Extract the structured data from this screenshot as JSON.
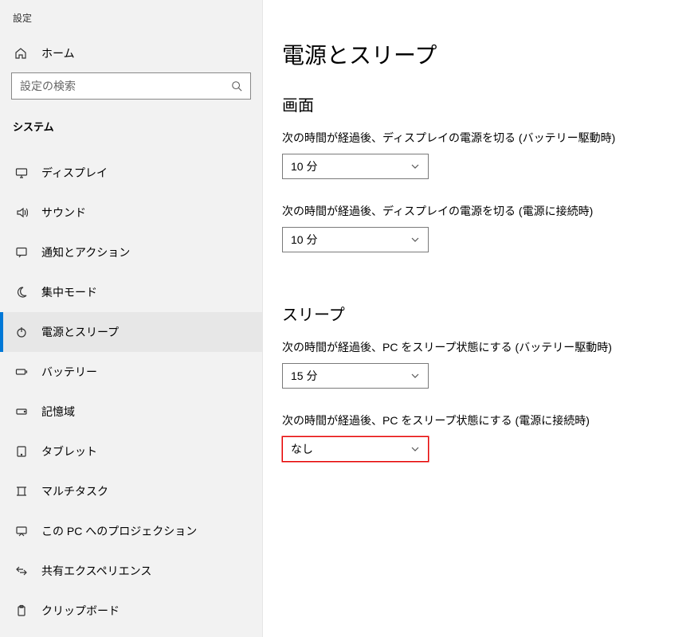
{
  "app_title": "設定",
  "sidebar": {
    "home_label": "ホーム",
    "search_placeholder": "設定の検索",
    "category": "システム",
    "items": [
      {
        "id": "display",
        "label": "ディスプレイ",
        "icon": "display-icon"
      },
      {
        "id": "sound",
        "label": "サウンド",
        "icon": "sound-icon"
      },
      {
        "id": "notifications",
        "label": "通知とアクション",
        "icon": "notification-icon"
      },
      {
        "id": "focus",
        "label": "集中モード",
        "icon": "moon-icon"
      },
      {
        "id": "power",
        "label": "電源とスリープ",
        "icon": "power-icon",
        "active": true
      },
      {
        "id": "battery",
        "label": "バッテリー",
        "icon": "battery-icon"
      },
      {
        "id": "storage",
        "label": "記憶域",
        "icon": "storage-icon"
      },
      {
        "id": "tablet",
        "label": "タブレット",
        "icon": "tablet-icon"
      },
      {
        "id": "multitask",
        "label": "マルチタスク",
        "icon": "multitask-icon"
      },
      {
        "id": "projection",
        "label": "この PC へのプロジェクション",
        "icon": "projection-icon"
      },
      {
        "id": "shared",
        "label": "共有エクスペリエンス",
        "icon": "shared-icon"
      },
      {
        "id": "clipboard",
        "label": "クリップボード",
        "icon": "clipboard-icon"
      }
    ]
  },
  "main": {
    "title": "電源とスリープ",
    "sections": {
      "screen": {
        "heading": "画面",
        "battery_label": "次の時間が経過後、ディスプレイの電源を切る (バッテリー駆動時)",
        "battery_value": "10 分",
        "plugged_label": "次の時間が経過後、ディスプレイの電源を切る (電源に接続時)",
        "plugged_value": "10 分"
      },
      "sleep": {
        "heading": "スリープ",
        "battery_label": "次の時間が経過後、PC をスリープ状態にする (バッテリー駆動時)",
        "battery_value": "15 分",
        "plugged_label": "次の時間が経過後、PC をスリープ状態にする (電源に接続時)",
        "plugged_value": "なし"
      }
    }
  },
  "colors": {
    "accent": "#0078d7",
    "highlight": "#e60000"
  }
}
